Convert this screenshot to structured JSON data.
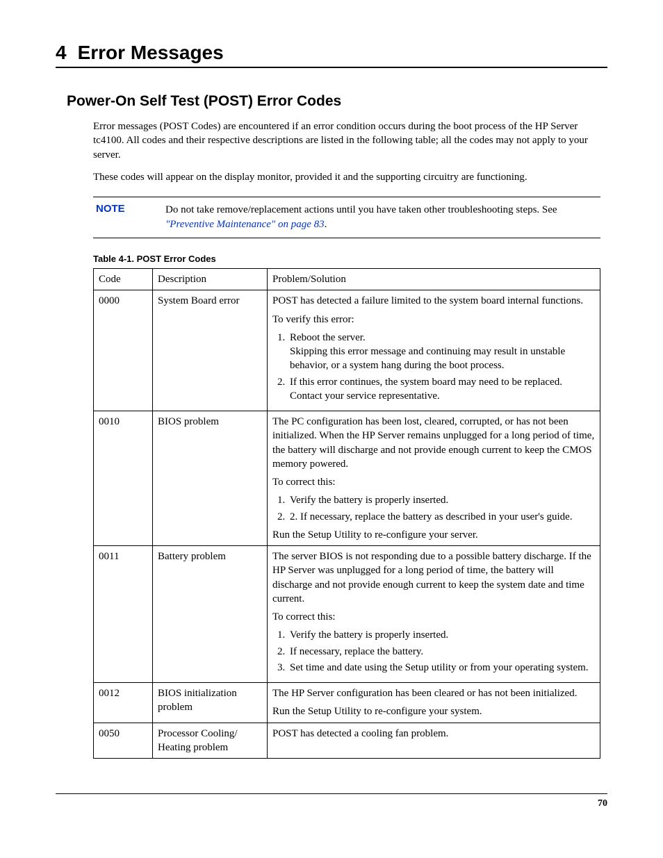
{
  "chapter": {
    "number": "4",
    "title": "Error Messages"
  },
  "section": {
    "title": "Power-On Self Test (POST) Error Codes"
  },
  "intro": {
    "p1": "Error messages (POST Codes) are encountered if an error condition occurs during the boot process of the HP Server tc4100. All codes and their respective descriptions are listed in the following table; all the codes may not apply to your server.",
    "p2": "These codes will appear on the display monitor, provided it and the supporting circuitry are functioning."
  },
  "note": {
    "label": "NOTE",
    "text_a": "Do not take remove/replacement actions until you have taken other troubleshooting steps. See ",
    "link": "\"Preventive Maintenance\" on page 83",
    "text_b": "."
  },
  "table": {
    "caption": "Table 4-1.  POST Error Codes",
    "headers": {
      "code": "Code",
      "desc": "Description",
      "sol": "Problem/Solution"
    },
    "rows": [
      {
        "code": "0000",
        "desc": "System Board error",
        "sol": {
          "p1": "POST has detected a failure limited to the system board internal functions.",
          "p2": "To verify this error:",
          "steps": [
            {
              "a": "Reboot the server.",
              "b": "Skipping this error message and continuing may result in unstable behavior, or a system hang during the boot process."
            },
            {
              "a": "If this error continues, the system board may need to be replaced. Contact your service representative."
            }
          ]
        }
      },
      {
        "code": "0010",
        "desc": "BIOS problem",
        "sol": {
          "p1": "The PC configuration has been lost, cleared, corrupted, or has not been initialized. When the HP Server remains unplugged for a long period of time, the battery will discharge and not provide enough current to keep the CMOS memory powered.",
          "p2": "To correct this:",
          "steps": [
            {
              "a": "Verify the battery is properly inserted."
            },
            {
              "a": "2. If necessary, replace the battery as described in your user's guide."
            }
          ],
          "p3": "Run the Setup Utility to re-configure your server."
        }
      },
      {
        "code": "0011",
        "desc": "Battery problem",
        "sol": {
          "p1": "The server BIOS is not responding due to a possible battery discharge. If the HP Server was unplugged for a long period of time, the battery will discharge and not provide enough current to keep the system date and time current.",
          "p2": "To correct this:",
          "steps": [
            {
              "a": "Verify the battery is properly inserted."
            },
            {
              "a": "If necessary, replace the battery."
            },
            {
              "a": "Set time and date using the Setup utility or from your operating system."
            }
          ]
        }
      },
      {
        "code": "0012",
        "desc": "BIOS  initialization problem",
        "sol": {
          "p1": "The HP Server configuration has been cleared or has not been initialized.",
          "p3": "Run the Setup Utility to re-configure your system."
        }
      },
      {
        "code": "0050",
        "desc": "Processor Cooling/ Heating problem",
        "sol": {
          "p1": "POST has detected a cooling fan problem."
        }
      }
    ]
  },
  "page_number": "70"
}
